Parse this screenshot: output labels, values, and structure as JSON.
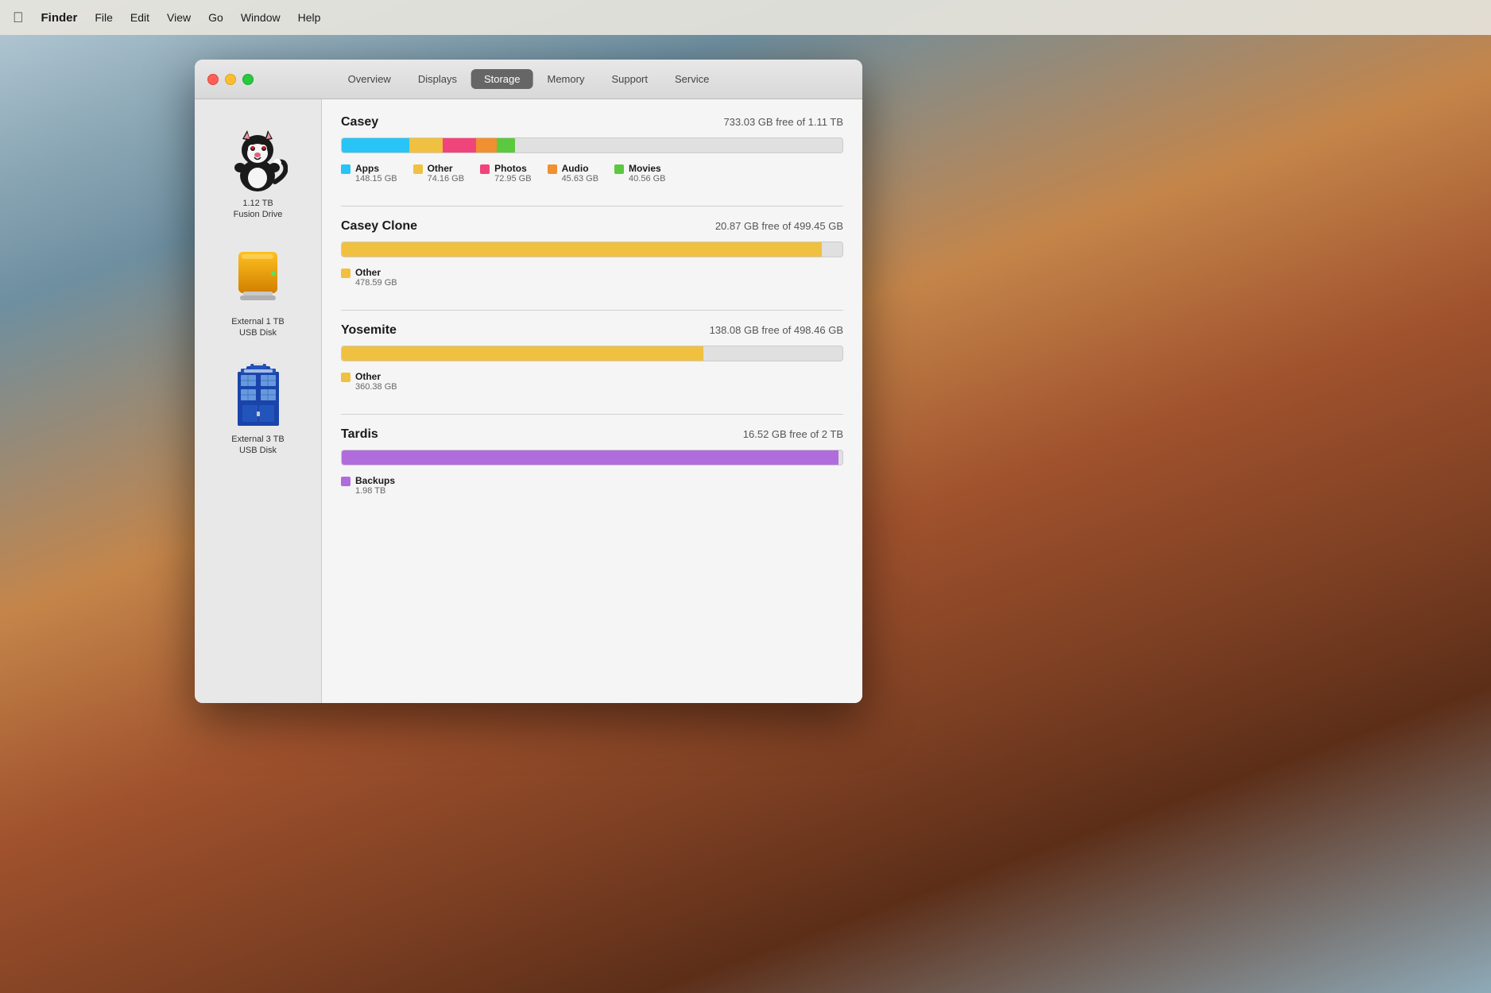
{
  "desktop": {
    "background": "yosemite"
  },
  "menubar": {
    "apple": "⌘",
    "app_name": "Finder",
    "items": [
      "File",
      "Edit",
      "View",
      "Go",
      "Window",
      "Help"
    ]
  },
  "window": {
    "traffic_lights": {
      "close": "close",
      "minimize": "minimize",
      "maximize": "maximize"
    },
    "tabs": [
      {
        "id": "overview",
        "label": "Overview",
        "active": false
      },
      {
        "id": "displays",
        "label": "Displays",
        "active": false
      },
      {
        "id": "storage",
        "label": "Storage",
        "active": true
      },
      {
        "id": "memory",
        "label": "Memory",
        "active": false
      },
      {
        "id": "support",
        "label": "Support",
        "active": false
      },
      {
        "id": "service",
        "label": "Service",
        "active": false
      }
    ],
    "sidebar": {
      "drives": [
        {
          "id": "casey",
          "icon_type": "sylvester",
          "label_line1": "1.12 TB",
          "label_line2": "Fusion Drive"
        },
        {
          "id": "casey-clone",
          "icon_type": "external-yellow",
          "label_line1": "External 1 TB",
          "label_line2": "USB Disk"
        },
        {
          "id": "tardis",
          "icon_type": "tardis",
          "label_line1": "External 3 TB",
          "label_line2": "USB Disk"
        }
      ]
    },
    "detail": {
      "sections": [
        {
          "id": "casey-detail",
          "name": "Casey",
          "free_text": "733.03 GB free of 1.11 TB",
          "total_gb": 1100,
          "bar_segments": [
            {
              "color": "#27c4f5",
              "pct": 13.5,
              "label": "Apps",
              "size": "148.15 GB"
            },
            {
              "color": "#f0c040",
              "pct": 6.7,
              "label": "Other",
              "size": "74.16 GB"
            },
            {
              "color": "#f0447c",
              "pct": 6.6,
              "label": "Photos",
              "size": "72.95 GB"
            },
            {
              "color": "#f09030",
              "pct": 4.1,
              "label": "Audio",
              "size": "45.63 GB"
            },
            {
              "color": "#5cc840",
              "pct": 3.7,
              "label": "Movies",
              "size": "40.56 GB"
            }
          ]
        },
        {
          "id": "casey-clone-detail",
          "name": "Casey Clone",
          "free_text": "20.87 GB free of 499.45 GB",
          "total_gb": 499.45,
          "bar_segments": [
            {
              "color": "#f0c040",
              "pct": 95.8,
              "label": "Other",
              "size": "478.59 GB"
            }
          ]
        },
        {
          "id": "yosemite-detail",
          "name": "Yosemite",
          "free_text": "138.08 GB free of 498.46 GB",
          "total_gb": 498.46,
          "bar_segments": [
            {
              "color": "#f0c040",
              "pct": 72.3,
              "label": "Other",
              "size": "360.38 GB"
            }
          ]
        },
        {
          "id": "tardis-detail",
          "name": "Tardis",
          "free_text": "16.52 GB free of 2 TB",
          "total_gb": 2000,
          "bar_segments": [
            {
              "color": "#b06cdd",
              "pct": 99.2,
              "label": "Backups",
              "size": "1.98 TB"
            }
          ]
        }
      ]
    }
  }
}
